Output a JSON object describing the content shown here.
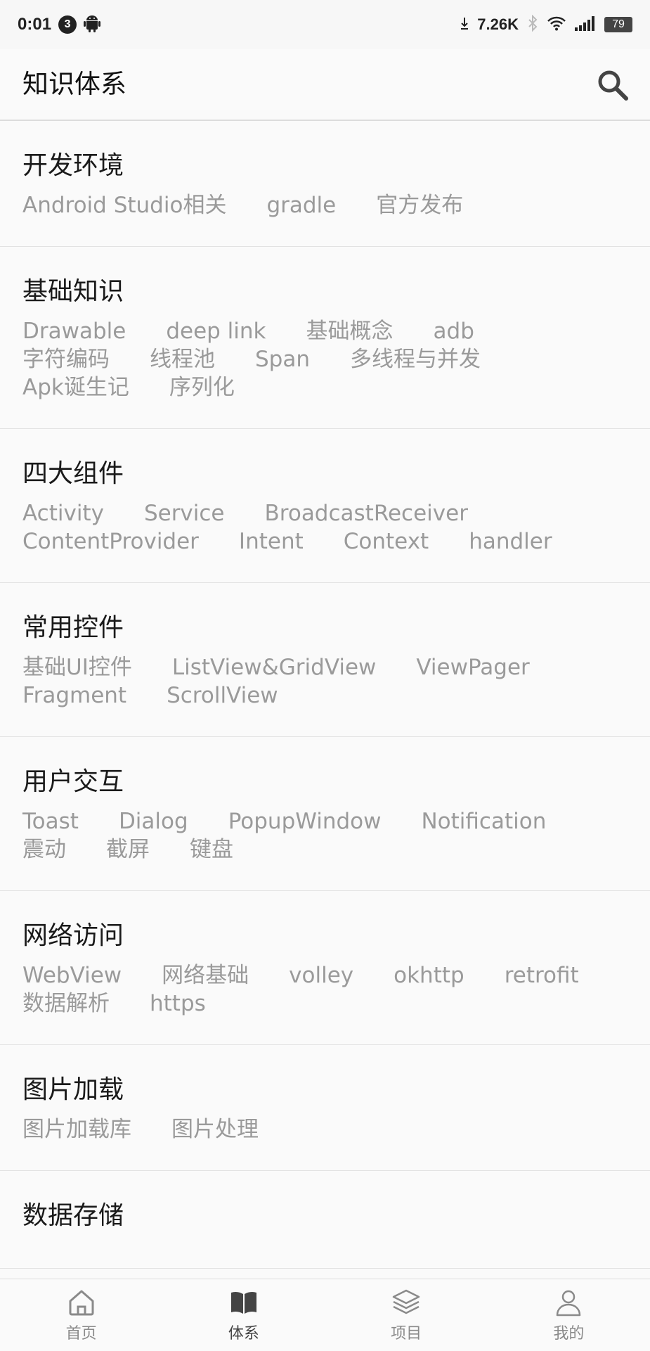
{
  "status_bar": {
    "time": "0:01",
    "notification_count": "3",
    "net_speed": "7.26K",
    "battery": "79"
  },
  "app_bar": {
    "title": "知识体系"
  },
  "categories": [
    {
      "title": "开发环境",
      "tags": [
        "Android Studio相关",
        "gradle",
        "官方发布"
      ]
    },
    {
      "title": "基础知识",
      "tags": [
        "Drawable",
        "deep link",
        "基础概念",
        "adb",
        "字符编码",
        "线程池",
        "Span",
        "多线程与并发",
        "Apk诞生记",
        "序列化"
      ]
    },
    {
      "title": "四大组件",
      "tags": [
        "Activity",
        "Service",
        "BroadcastReceiver",
        "ContentProvider",
        "Intent",
        "Context",
        "handler"
      ]
    },
    {
      "title": "常用控件",
      "tags": [
        "基础UI控件",
        "ListView&GridView",
        "ViewPager",
        "Fragment",
        "ScrollView"
      ]
    },
    {
      "title": "用户交互",
      "tags": [
        "Toast",
        "Dialog",
        "PopupWindow",
        "Notification",
        "震动",
        "截屏",
        "键盘"
      ]
    },
    {
      "title": "网络访问",
      "tags": [
        "WebView",
        "网络基础",
        "volley",
        "okhttp",
        "retrofit",
        "数据解析",
        "https"
      ]
    },
    {
      "title": "图片加载",
      "tags": [
        "图片加载库",
        "图片处理"
      ]
    },
    {
      "title": "数据存储",
      "tags": []
    }
  ],
  "bottom_nav": [
    {
      "label": "首页",
      "icon": "home-icon"
    },
    {
      "label": "体系",
      "icon": "book-icon",
      "active": true
    },
    {
      "label": "项目",
      "icon": "layers-icon"
    },
    {
      "label": "我的",
      "icon": "user-icon"
    }
  ]
}
